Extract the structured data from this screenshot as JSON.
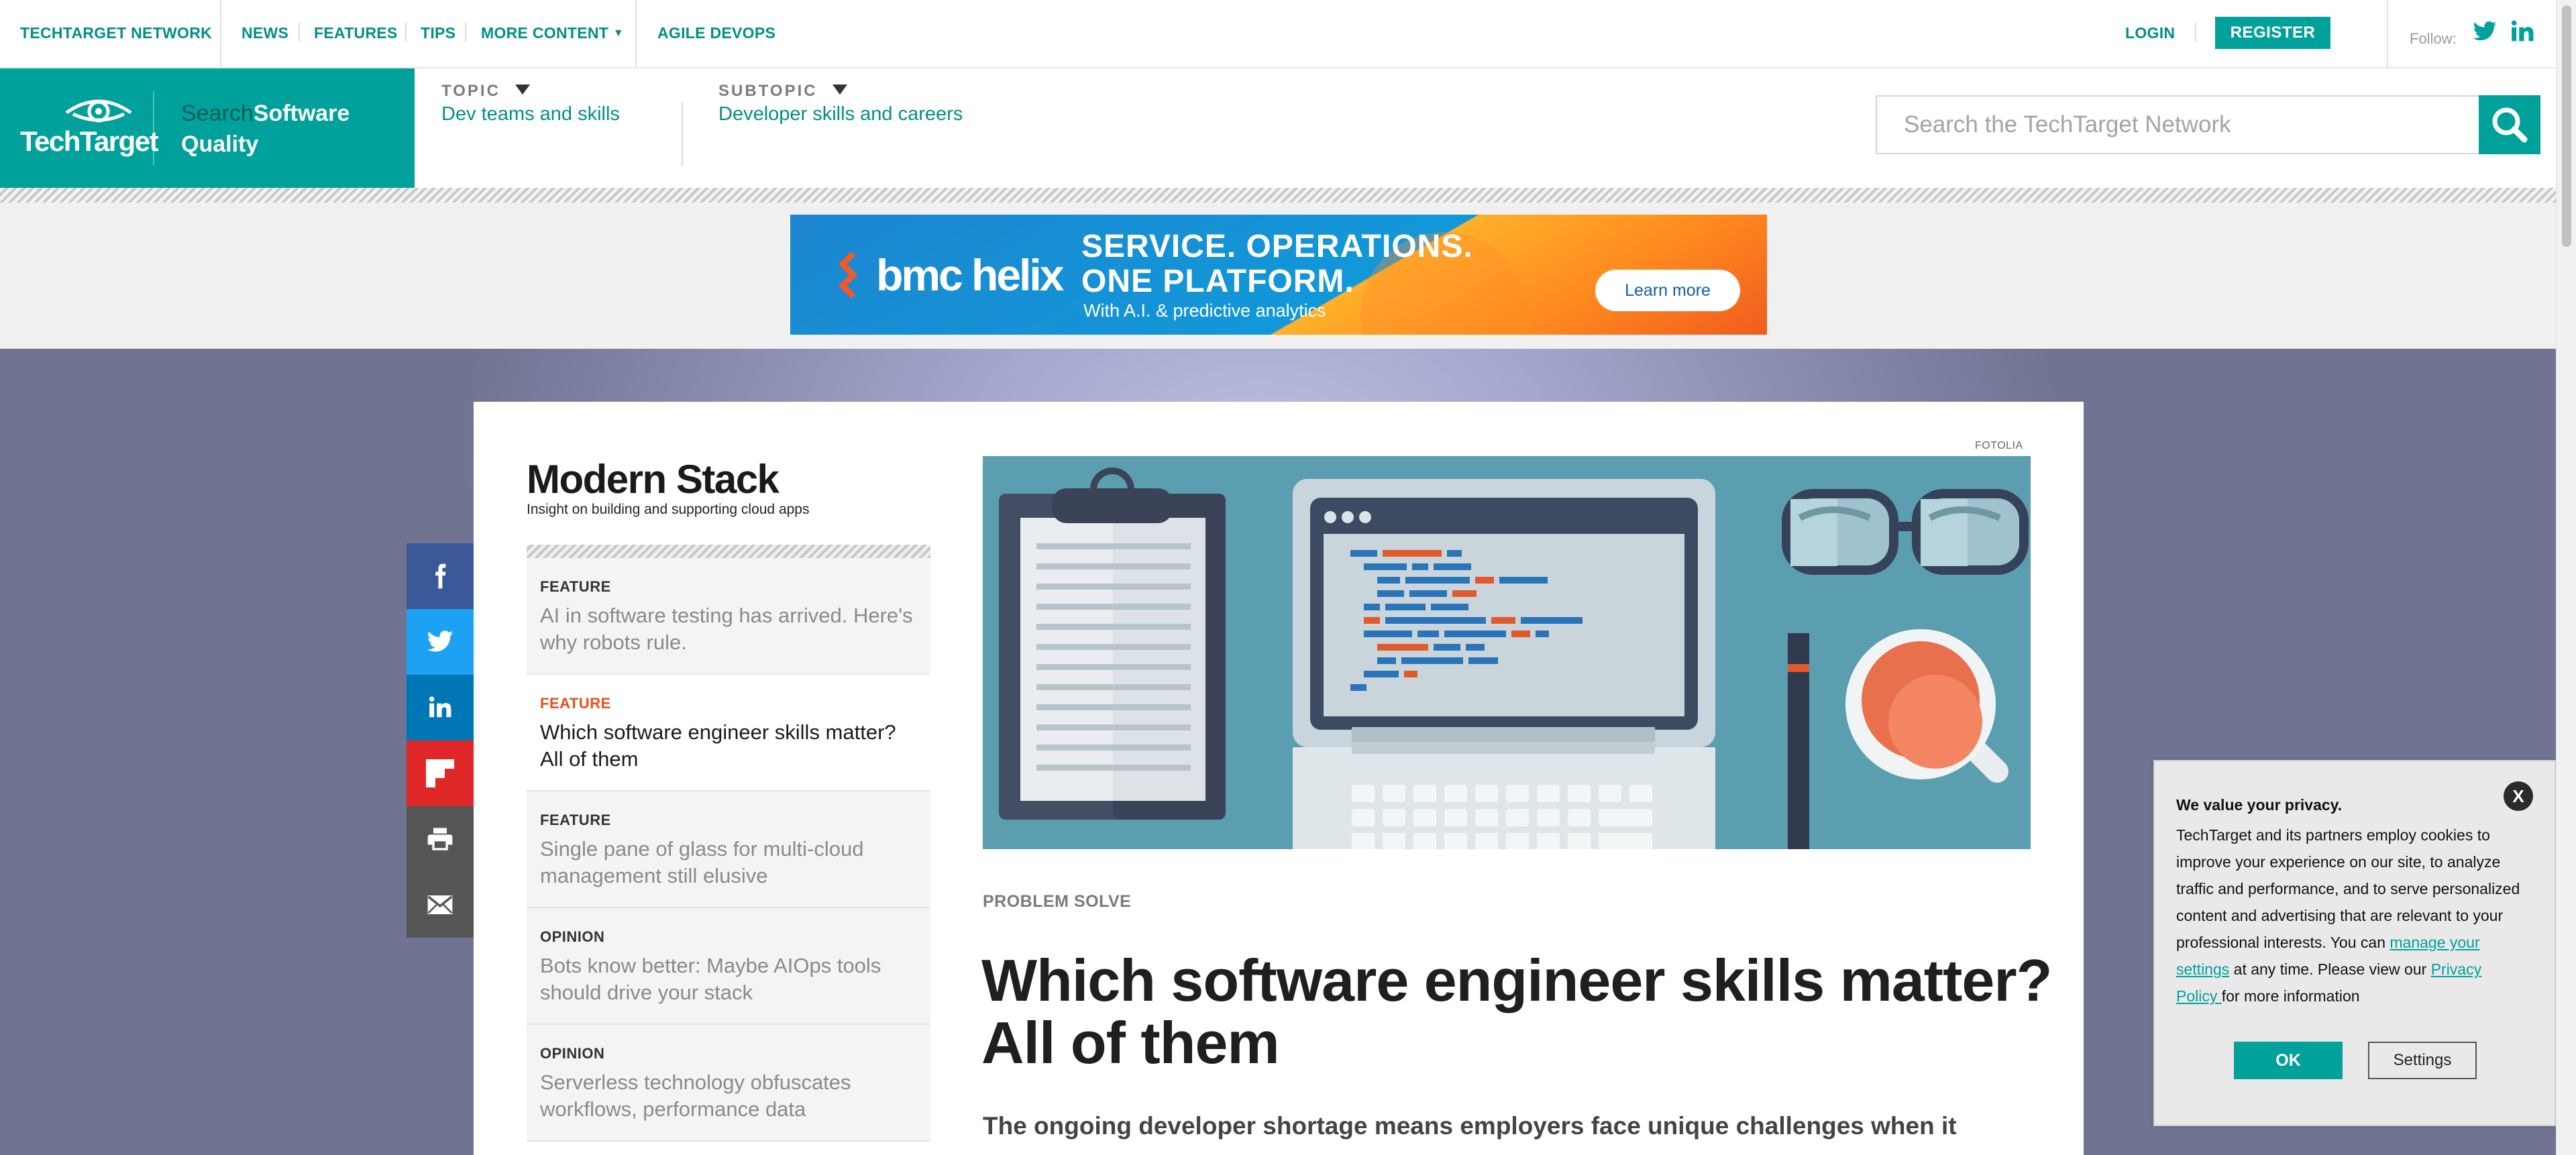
{
  "topnav": {
    "network": "TECHTARGET NETWORK",
    "news": "NEWS",
    "features": "FEATURES",
    "tips": "TIPS",
    "more_content": "MORE CONTENT",
    "agile_devops": "AGILE DEVOPS",
    "login": "LOGIN",
    "register": "REGISTER",
    "follow": "Follow:"
  },
  "header": {
    "logo": "TechTarget",
    "site_prefix": "Search",
    "site_name_1": "Software",
    "site_name_2": "Quality",
    "topic_label": "TOPIC",
    "topic_value": "Dev teams and skills",
    "subtopic_label": "SUBTOPIC",
    "subtopic_value": "Developer skills and careers",
    "search_placeholder": "Search the TechTarget Network"
  },
  "ad": {
    "brand": "bmc helix",
    "headline_1": "SERVICE. OPERATIONS.",
    "headline_2": "ONE PLATFORM.",
    "subline": "With A.I. & predictive analytics",
    "cta": "Learn more"
  },
  "share": {
    "icons": [
      "facebook-icon",
      "twitter-icon",
      "linkedin-icon",
      "flipboard-icon",
      "print-icon",
      "email-icon"
    ],
    "colors": [
      "#3b5998",
      "#1da1f2",
      "#0077b5",
      "#e12828",
      "#555555",
      "#555555"
    ]
  },
  "sidebar": {
    "title": "Modern Stack",
    "subtitle": "Insight on building and supporting cloud apps",
    "items": [
      {
        "type": "FEATURE",
        "title": "AI in software testing has arrived. Here's why robots rule."
      },
      {
        "type": "FEATURE",
        "title": "Which software engineer skills matter? All of them"
      },
      {
        "type": "FEATURE",
        "title": "Single pane of glass for multi-cloud management still elusive"
      },
      {
        "type": "OPINION",
        "title": "Bots know better: Maybe AIOps tools should drive your stack"
      },
      {
        "type": "OPINION",
        "title": "Serverless technology obfuscates workflows, performance data"
      }
    ]
  },
  "article": {
    "photo_credit": "FOTOLIA",
    "kicker": "PROBLEM SOLVE",
    "headline": "Which software engineer skills matter? All of them",
    "lede": "The ongoing developer shortage means employers face unique challenges when it"
  },
  "privacy": {
    "close": "X",
    "title": "We value your privacy.",
    "body_1": "TechTarget and its partners employ cookies to improve your experience on our site, to analyze traffic and performance, and to serve personalized content and advertising that are relevant to your professional interests. You can ",
    "link_1": "manage your settings",
    "body_2": " at any time. Please view our ",
    "link_2": "Privacy Policy ",
    "body_3": "for more information",
    "ok": "OK",
    "settings": "Settings"
  },
  "colors": {
    "brand_teal": "#00a19a",
    "accent_orange": "#e84f1c"
  }
}
